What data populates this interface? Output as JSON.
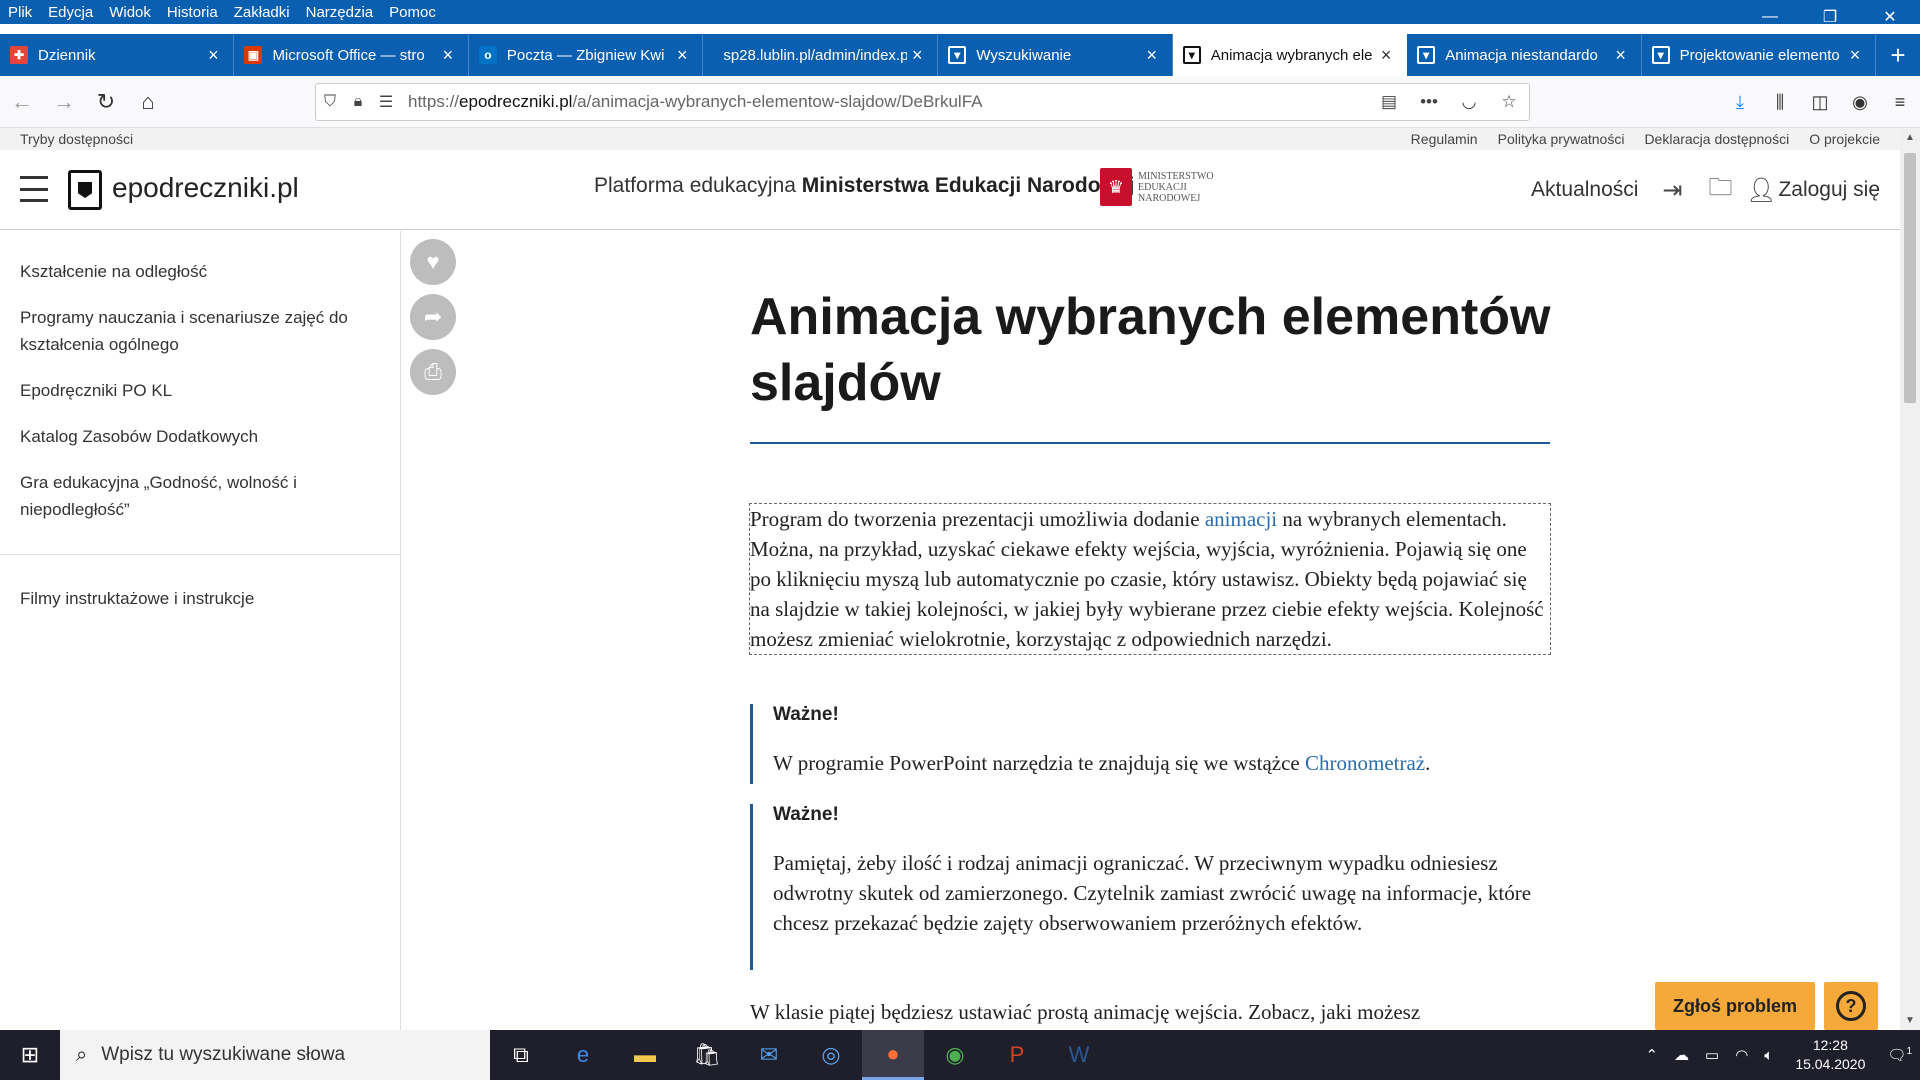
{
  "menu": [
    "Plik",
    "Edycja",
    "Widok",
    "Historia",
    "Zakładki",
    "Narzędzia",
    "Pomoc"
  ],
  "window_controls": {
    "minimize": "—",
    "restore": "❐",
    "close": "✕"
  },
  "tabs": [
    {
      "title": "Dziennik",
      "favicon_color": "#e2463a",
      "icon": "dziennik-icon"
    },
    {
      "title": "Microsoft Office — stro",
      "favicon_color": "#d83b01",
      "icon": "office-icon"
    },
    {
      "title": "Poczta — Zbigniew Kwi",
      "favicon_color": "#0072c6",
      "icon": "outlook-icon"
    },
    {
      "title": "sp28.lublin.pl/admin/index.p",
      "favicon_color": "",
      "icon": "none"
    },
    {
      "title": "Wyszukiwanie",
      "favicon_color": "#111111",
      "icon": "epodreczniki-icon"
    },
    {
      "title": "Animacja wybranych ele",
      "favicon_color": "#111111",
      "icon": "epodreczniki-icon",
      "active": true
    },
    {
      "title": "Animacja niestandardo",
      "favicon_color": "#111111",
      "icon": "epodreczniki-icon"
    },
    {
      "title": "Projektowanie elemento",
      "favicon_color": "#111111",
      "icon": "epodreczniki-icon"
    }
  ],
  "navbar": {
    "url_prefix": "https://",
    "url_domain": "epodreczniki.pl",
    "url_path": "/a/animacja-wybranych-elementow-slajdow/DeBrkulFA"
  },
  "a11ybar": {
    "left": "Tryby dostępności",
    "links": [
      "Regulamin",
      "Polityka prywatności",
      "Deklaracja dostępności",
      "O projekcie"
    ]
  },
  "header": {
    "logo_text": "epodreczniki.pl",
    "platform_prefix": "Platforma edukacyjna ",
    "platform_bold": "Ministerstwa Edukacji Narodowej",
    "men_logo_lines": [
      "MINISTERSTWO",
      "EDUKACJI",
      "NARODOWEJ"
    ],
    "news": "Aktualności",
    "login": "Zaloguj się"
  },
  "sidebar": [
    "Kształcenie na odległość",
    "Programy nauczania i scenariusze zajęć do kształcenia ogólnego",
    "Epodręczniki PO KL",
    "Katalog Zasobów Dodatkowych",
    "Gra edukacyjna „Godność, wolność i niepodległość”",
    "Filmy instruktażowe i instrukcje"
  ],
  "article": {
    "title": "Animacja wybranych elementów slajdów",
    "intro_pre": "Program do tworzenia prezentacji umożliwia dodanie ",
    "intro_link": "animacji",
    "intro_post": " na wybranych elementach. Można, na przykład, uzyskać ciekawe efekty wejścia, wyjścia, wyróżnienia. Pojawią się one po kliknięciu myszą lub automatycznie po czasie, który ustawisz. Obiekty będą pojawiać się na slajdzie w takiej kolejności, w jakiej były wybierane przez ciebie efekty wejścia. Kolejność możesz zmieniać wielokrotnie, korzystając z odpowiednich narzędzi.",
    "callout1_title": "Ważne!",
    "callout1_pre": "W programie PowerPoint narzędzia te znajdują się we wstążce ",
    "callout1_link": "Chronometraż",
    "callout1_post": ".",
    "callout2_title": "Ważne!",
    "callout2_body": "Pamiętaj, żeby ilość i rodzaj animacji ograniczać. W przeciwnym wypadku odniesiesz odwrotny skutek od zamierzonego. Czytelnik zamiast zwrócić uwagę na informacje, które chcesz przekazać będzie zajęty obserwowaniem przeróżnych efektów.",
    "para": "W klasie piątej będziesz ustawiać prostą animację wejścia. Zobacz, jaki możesz"
  },
  "floating": {
    "report": "Zgłoś problem",
    "help": "?"
  },
  "taskbar": {
    "search_placeholder": "Wpisz tu wyszukiwane słowa",
    "time": "12:28",
    "date": "15.04.2020",
    "notif_count": "1"
  },
  "colors": {
    "accent": "#0b5fb0",
    "link": "#2a6dad",
    "rule": "#1e5a94",
    "report": "#f4a93a"
  }
}
